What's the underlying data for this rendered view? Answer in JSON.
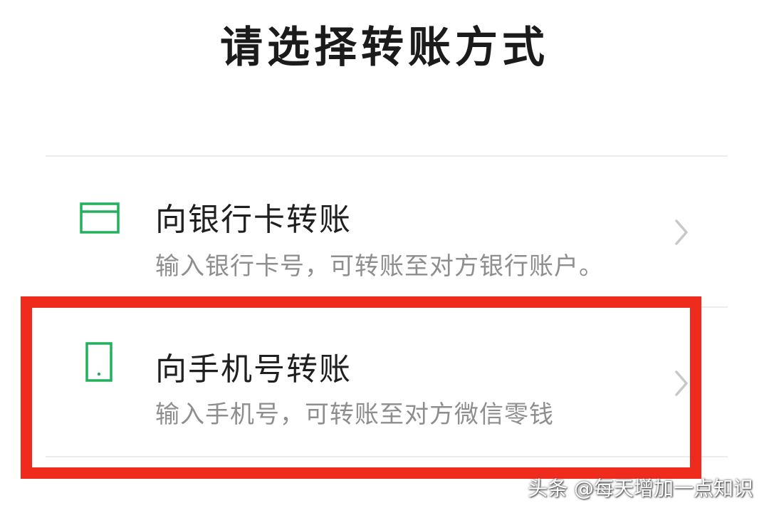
{
  "page": {
    "title": "请选择转账方式"
  },
  "options": [
    {
      "title": "向银行卡转账",
      "description": "输入银行卡号，可转账至对方银行账户。",
      "icon": "bank-card-icon"
    },
    {
      "title": "向手机号转账",
      "description": "输入手机号，可转账至对方微信零钱",
      "icon": "mobile-phone-icon"
    }
  ],
  "watermark": {
    "text": "头条 @每天增加一点知识"
  },
  "colors": {
    "icon_green": "#21b05c",
    "highlight_red": "#ee2b1d",
    "chevron_gray": "#c8c8c8",
    "description_gray": "#8e8e8e"
  }
}
